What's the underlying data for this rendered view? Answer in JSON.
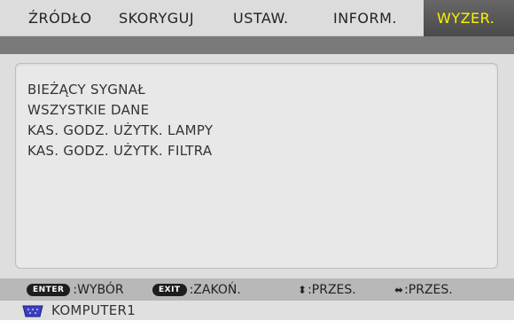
{
  "tabs": [
    {
      "label": "ŹRÓDŁO"
    },
    {
      "label": "SKORYGUJ"
    },
    {
      "label": "USTAW."
    },
    {
      "label": "INFORM."
    },
    {
      "label": "WYZER.",
      "active": true
    }
  ],
  "menu": {
    "items": [
      {
        "label": "BIEŻĄCY SYGNAŁ"
      },
      {
        "label": "WSZYSTKIE DANE"
      },
      {
        "label": "KAS. GODZ. UŻYTK. LAMPY"
      },
      {
        "label": "KAS. GODZ. UŻYTK. FILTRA"
      }
    ]
  },
  "footer": {
    "enter_key": "ENTER",
    "enter_text": ":WYBÓR",
    "exit_key": "EXIT",
    "exit_text": ":ZAKOŃ.",
    "updown_arrow": "⬍",
    "updown_text": ":PRZES.",
    "leftright_arrow": "⬌",
    "leftright_text": ":PRZES."
  },
  "status": {
    "source_icon": "vga-connector-icon",
    "source_label": "KOMPUTER1"
  },
  "colors": {
    "active_tab_text": "#fff200",
    "active_tab_bg": "#555555",
    "subbar": "#7a7a7a",
    "icon_blue": "#3a3fc4"
  }
}
